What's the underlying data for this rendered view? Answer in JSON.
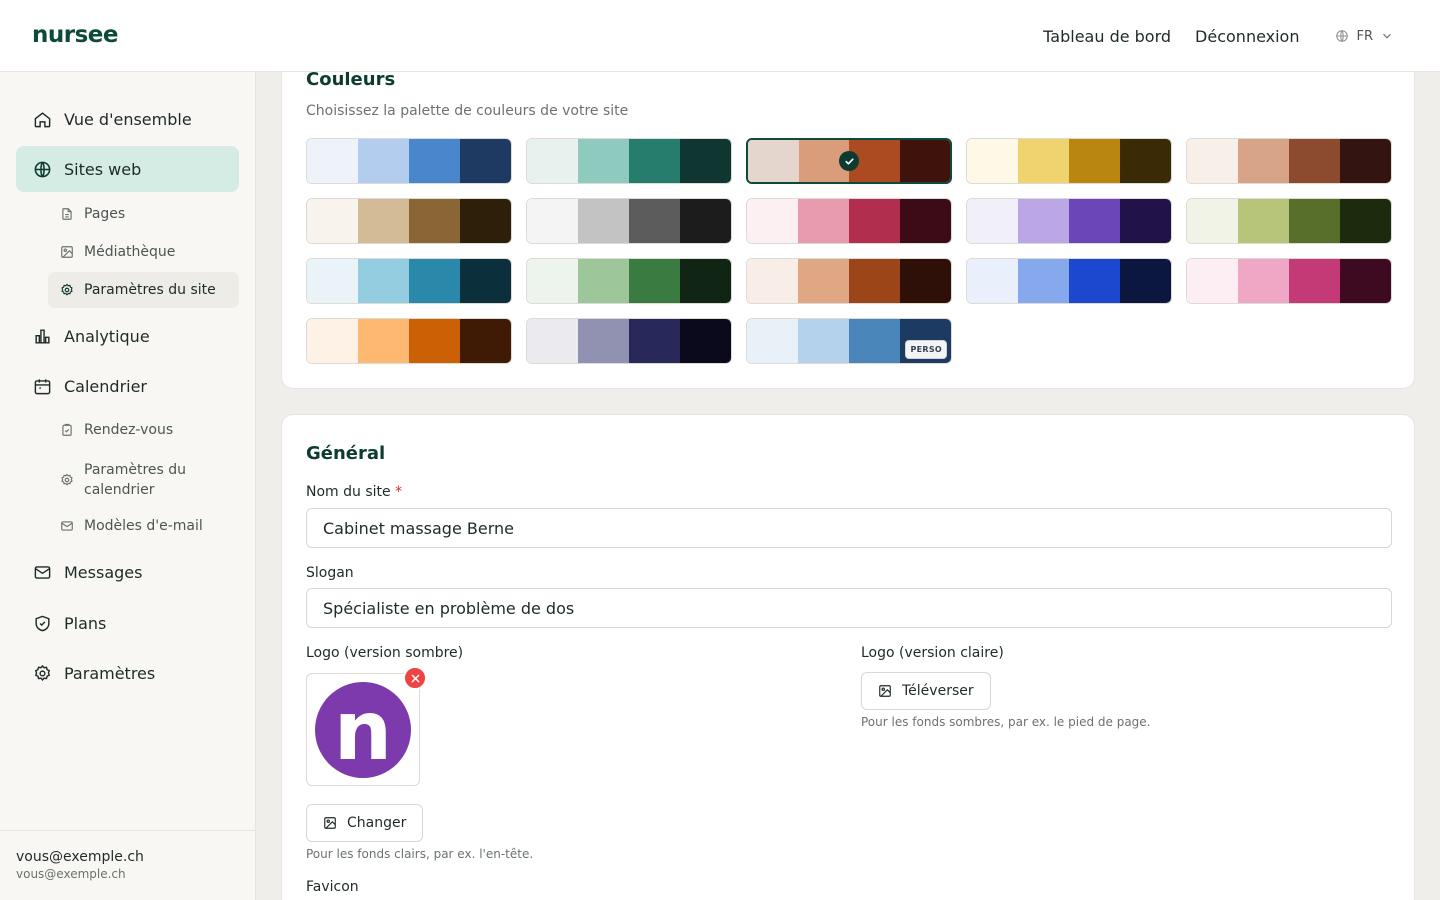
{
  "header": {
    "brand": "nursee",
    "nav": [
      {
        "label": "Tableau de bord"
      },
      {
        "label": "Déconnexion"
      }
    ],
    "language": "FR"
  },
  "sidebar": {
    "items": [
      {
        "label": "Vue d'ensemble",
        "icon": "home-icon"
      },
      {
        "label": "Sites web",
        "icon": "globe-icon",
        "active": true
      },
      {
        "label": "Analytique",
        "icon": "bar-chart-icon"
      },
      {
        "label": "Calendrier",
        "icon": "calendar-icon"
      },
      {
        "label": "Messages",
        "icon": "mail-icon"
      },
      {
        "label": "Plans",
        "icon": "shield-icon"
      },
      {
        "label": "Paramètres",
        "icon": "gear-icon"
      }
    ],
    "site_subitems": [
      {
        "label": "Pages",
        "icon": "file-icon"
      },
      {
        "label": "Médiathèque",
        "icon": "image-icon"
      },
      {
        "label": "Paramètres du site",
        "icon": "gear-icon",
        "active": true
      }
    ],
    "calendar_subitems": [
      {
        "label": "Rendez-vous",
        "icon": "clipboard-icon"
      },
      {
        "label": "Paramètres du calendrier",
        "icon": "gear-icon"
      },
      {
        "label": "Modèles d'e-mail",
        "icon": "mail-icon"
      }
    ],
    "user": {
      "name": "vous@exemple.ch",
      "email": "vous@exemple.ch"
    }
  },
  "colors_section": {
    "title": "Couleurs",
    "description": "Choisissez la palette de couleurs de votre site",
    "selected_index": 2,
    "custom_badge": "PERSO",
    "palettes": [
      [
        "#eef3fb",
        "#b3cdee",
        "#4a86cc",
        "#1e3a63"
      ],
      [
        "#e8f1ee",
        "#8ecbbe",
        "#277d6d",
        "#0f3630"
      ],
      [
        "#e4d5cd",
        "#d99d7c",
        "#ac4a22",
        "#3f130b"
      ],
      [
        "#fef8e6",
        "#f0d36f",
        "#b9870f",
        "#3a2a06"
      ],
      [
        "#f8efe9",
        "#d7a487",
        "#8c4a2e",
        "#331410"
      ],
      [
        "#f8f3ec",
        "#d4bb97",
        "#8a6637",
        "#2e1f0a"
      ],
      [
        "#f4f4f4",
        "#c3c3c3",
        "#5c5c5c",
        "#1c1c1c"
      ],
      [
        "#fdf0f2",
        "#e89baf",
        "#b12e4e",
        "#3d0a18"
      ],
      [
        "#f1effa",
        "#bba6e8",
        "#6b46b8",
        "#211349"
      ],
      [
        "#f1f3e7",
        "#b6c57a",
        "#586e2b",
        "#1c2a0e"
      ],
      [
        "#eaf3f8",
        "#94cde0",
        "#2a89ab",
        "#0c2f3c"
      ],
      [
        "#edf4ed",
        "#9dc79a",
        "#397b41",
        "#102513"
      ],
      [
        "#f9ede7",
        "#e0a784",
        "#9c4518",
        "#2f1008"
      ],
      [
        "#e9f0fb",
        "#85a9ec",
        "#1c47cf",
        "#0c1740"
      ],
      [
        "#fdeef3",
        "#f0a6c5",
        "#c43a76",
        "#3d0a22"
      ],
      [
        "#fef2e6",
        "#fdb872",
        "#cb6104",
        "#3f1a04"
      ],
      [
        "#ebebef",
        "#9191b1",
        "#28285a",
        "#0a0a1c"
      ],
      [
        "#e8f0f8",
        "#b4d2ec",
        "#4b86bb",
        "#1d3a62"
      ]
    ]
  },
  "general_section": {
    "title": "Général",
    "site_name": {
      "label": "Nom du site",
      "required_mark": "*",
      "value": "Cabinet massage Berne"
    },
    "slogan": {
      "label": "Slogan",
      "value": "Spécialiste en problème de dos"
    },
    "logo_dark": {
      "label": "Logo (version sombre)",
      "logo_letter": "n",
      "change_label": "Changer",
      "hint": "Pour les fonds clairs, par ex. l'en-tête."
    },
    "logo_light": {
      "label": "Logo (version claire)",
      "upload_label": "Téléverser",
      "hint": "Pour les fonds sombres, par ex. le pied de page."
    },
    "favicon": {
      "label": "Favicon"
    }
  },
  "colors": {
    "brand": "#0d4a3a",
    "active_nav_bg": "#d4ece3",
    "logo_purple": "#7c3aad",
    "danger": "#ef4444"
  }
}
